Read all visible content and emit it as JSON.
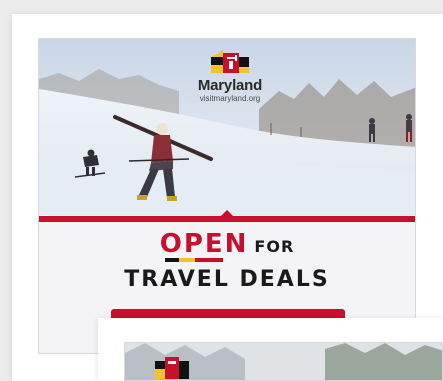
{
  "ad_main": {
    "brand": "Maryland",
    "url": "visitmaryland.org",
    "headline_open": "OPEN",
    "headline_for": "FOR",
    "headline_deals": "TRAVEL DEALS"
  },
  "colors": {
    "accent_red": "#c8102e",
    "gold": "#f2c230",
    "text_dark": "#1a1a1a"
  },
  "icons": {
    "logo": "maryland-flag-icon"
  }
}
